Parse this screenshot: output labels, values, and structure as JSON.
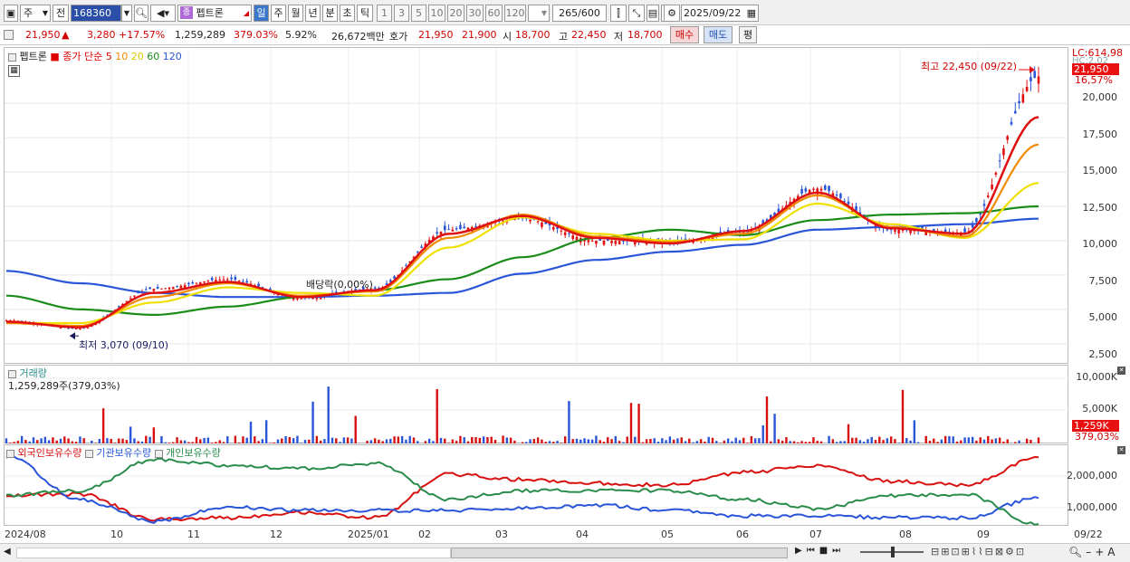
{
  "toolbar": {
    "chart_type": "주",
    "prev_label": "전",
    "stock_code": "168360",
    "stock_badge": "종",
    "stock_name": "펩트론",
    "periods": [
      "일",
      "주",
      "월",
      "년",
      "분",
      "초",
      "틱"
    ],
    "active_period": "일",
    "intervals": [
      "1",
      "3",
      "5",
      "10",
      "20",
      "30",
      "60",
      "120"
    ],
    "count": "265",
    "count_max": "/600",
    "date": "2025/09/22"
  },
  "quote": {
    "price": "21,950",
    "change_arrow": "▲",
    "change": "3,280",
    "change_pct": "+17.57%",
    "volume": "1,259,289",
    "volume_ratio": "379.03%",
    "turnover_pct": "5.92%",
    "trade_value": "26,672백만",
    "hoga_label": "호가",
    "ask": "21,950",
    "bid": "21,900",
    "open_label": "시",
    "open": "18,700",
    "high_label": "고",
    "high": "22,450",
    "low_label": "저",
    "low": "18,700",
    "buy_label": "매수",
    "sell_label": "매도",
    "eval_label": "평"
  },
  "main_panel": {
    "stock_tab": "펩트론",
    "ma_title": "종가 단순",
    "ma_periods": [
      "5",
      "10",
      "20",
      "60",
      "120"
    ],
    "ma_colors": [
      "#e01010",
      "#f08a00",
      "#f0e000",
      "#1a8c1a",
      "#2a55d8"
    ],
    "annotation_high": "최고 22,450 (09/22)",
    "annotation_low": "최저 3,070 (09/10)",
    "annotation_dividend": "배당락(0,00%)",
    "y_ticks": [
      "20,000",
      "17,500",
      "15,000",
      "12,500",
      "10,000",
      "7,500",
      "5,000",
      "2,500"
    ],
    "lc_label": "LC:614,98",
    "hc_label": "HC:2,02",
    "price_tag": "21,950",
    "pct_tag": "16,57%"
  },
  "volume_panel": {
    "title": "거래량",
    "info": "1,259,289주(379,03%)",
    "y_ticks": [
      "10,000K",
      "5,000K"
    ],
    "tag": "1,259K",
    "tag_pct": "379,03%"
  },
  "holding_panel": {
    "legend": [
      "외국인보유수량",
      "기관보유수량",
      "개인보유수량"
    ],
    "legend_colors": [
      "#d81010",
      "#2a55d8",
      "#2a8c4a"
    ],
    "y_ticks": [
      "2,000,000",
      "1,000,000"
    ]
  },
  "x_axis": {
    "labels": [
      "2024/08",
      "10",
      "11",
      "12",
      "2025/01",
      "02",
      "03",
      "04",
      "05",
      "06",
      "07",
      "08",
      "09"
    ],
    "end_label": "09/22"
  },
  "chart_data": {
    "type": "candlestick",
    "x": [
      "2024/08",
      "2024/09",
      "2024/10",
      "2024/11",
      "2024/12",
      "2025/01",
      "2025/02",
      "2025/03",
      "2025/04",
      "2025/05",
      "2025/06",
      "2025/07",
      "2025/08",
      "2025/09",
      "2025/09/22"
    ],
    "close": [
      4200,
      3600,
      6500,
      7200,
      5800,
      6500,
      10800,
      11600,
      10000,
      9900,
      10600,
      13800,
      10800,
      10600,
      21950
    ],
    "ma5": [
      4100,
      3700,
      6200,
      7000,
      5900,
      6400,
      10500,
      11800,
      10200,
      9800,
      10700,
      13500,
      10900,
      10500,
      19000
    ],
    "ma10": [
      4000,
      3800,
      5900,
      6900,
      6000,
      6300,
      10200,
      11900,
      10300,
      9900,
      10500,
      13300,
      11000,
      10300,
      17000
    ],
    "ma20": [
      4000,
      4000,
      5500,
      6600,
      6200,
      6000,
      9500,
      11700,
      10500,
      10000,
      10100,
      12700,
      11200,
      10200,
      14200
    ],
    "ma60": [
      6000,
      5000,
      4600,
      5200,
      5900,
      6400,
      7200,
      8800,
      10200,
      10800,
      10400,
      11500,
      11900,
      12000,
      12500
    ],
    "ma120": [
      7800,
      6900,
      6200,
      5900,
      5900,
      6000,
      6200,
      7600,
      8600,
      9200,
      9700,
      10800,
      11000,
      11200,
      11600
    ],
    "high_point": {
      "value": 22450,
      "date": "09/22"
    },
    "low_point": {
      "value": 3070,
      "date": "09/10"
    },
    "ylim": [
      1500,
      23500
    ]
  }
}
